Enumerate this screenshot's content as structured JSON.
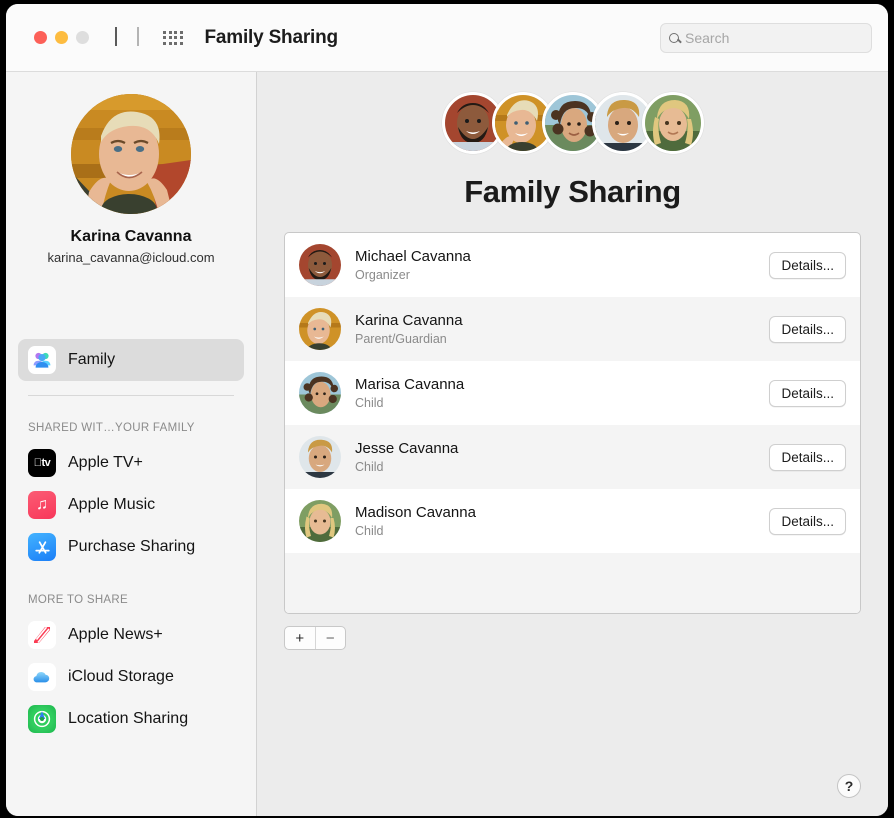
{
  "window": {
    "title": "Family Sharing",
    "traffic_lights": [
      "close",
      "minimize",
      "zoom"
    ]
  },
  "toolbar": {
    "back_icon": "chevron-left-icon",
    "forward_icon": "chevron-right-icon",
    "grid_icon": "grid-icon",
    "search": {
      "placeholder": "Search",
      "value": "",
      "icon": "search-icon"
    }
  },
  "sidebar": {
    "profile": {
      "name": "Karina Cavanna",
      "email": "karina_cavanna@icloud.com",
      "avatar": "karina-avatar"
    },
    "primary_items": [
      {
        "label": "Family",
        "icon": "family-icon",
        "selected": true
      }
    ],
    "sections": [
      {
        "header": "SHARED WIT…YOUR FAMILY",
        "items": [
          {
            "label": "Apple TV+",
            "icon": "apple-tv-icon"
          },
          {
            "label": "Apple Music",
            "icon": "apple-music-icon"
          },
          {
            "label": "Purchase Sharing",
            "icon": "app-store-icon"
          }
        ]
      },
      {
        "header": "MORE TO SHARE",
        "items": [
          {
            "label": "Apple News+",
            "icon": "apple-news-icon"
          },
          {
            "label": "iCloud Storage",
            "icon": "icloud-icon"
          },
          {
            "label": "Location Sharing",
            "icon": "find-my-icon"
          }
        ]
      }
    ]
  },
  "main": {
    "title": "Family Sharing",
    "avatar_cluster": [
      "michael-avatar",
      "karina-avatar",
      "marisa-avatar",
      "jesse-avatar",
      "madison-avatar"
    ],
    "members": [
      {
        "name": "Michael Cavanna",
        "role": "Organizer",
        "button": "Details...",
        "avatar": "michael-avatar"
      },
      {
        "name": "Karina Cavanna",
        "role": "Parent/Guardian",
        "button": "Details...",
        "avatar": "karina-avatar"
      },
      {
        "name": "Marisa Cavanna",
        "role": "Child",
        "button": "Details...",
        "avatar": "marisa-avatar"
      },
      {
        "name": "Jesse Cavanna",
        "role": "Child",
        "button": "Details...",
        "avatar": "jesse-avatar"
      },
      {
        "name": "Madison Cavanna",
        "role": "Child",
        "button": "Details...",
        "avatar": "madison-avatar"
      }
    ],
    "footer": {
      "add_label": "+",
      "remove_label": "−",
      "help_label": "?"
    }
  },
  "colors": {
    "window_background": "#ececec",
    "sidebar_background": "#f5f5f5",
    "toolbar_background": "#fbfbfb",
    "list_background": "#ffffff",
    "list_alt_row": "#f4f4f4",
    "selected_item": "#dcdcdc",
    "traffic_red": "#fc6058",
    "traffic_yellow": "#fdbc40",
    "traffic_grey": "#dedede",
    "secondary_text": "#8a8a8a"
  }
}
